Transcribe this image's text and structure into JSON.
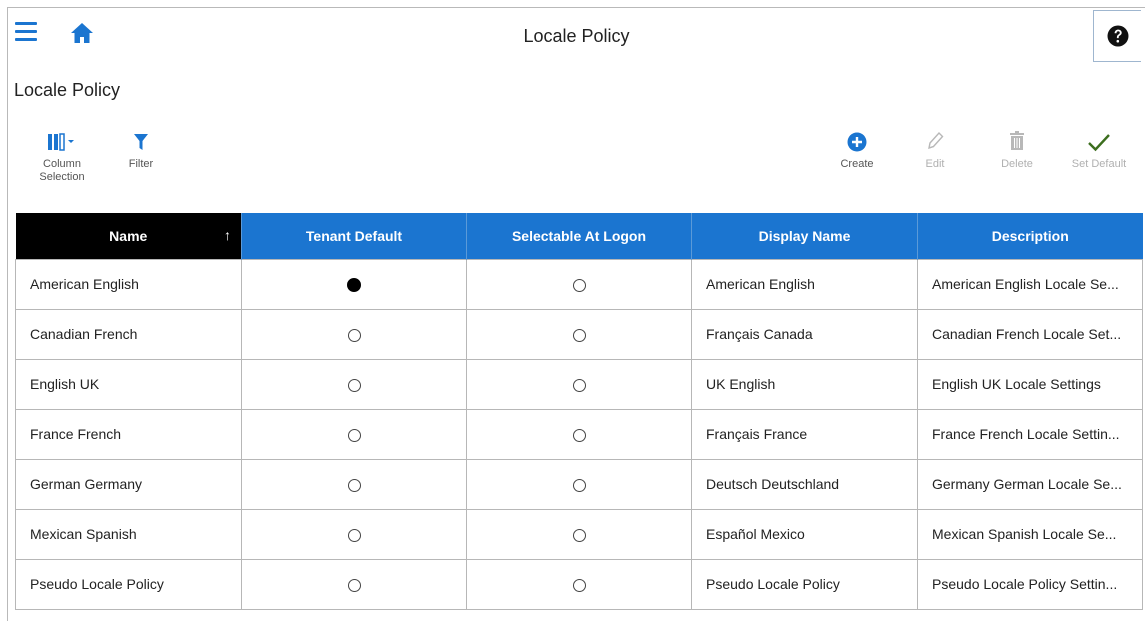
{
  "header": {
    "title": "Locale Policy"
  },
  "page": {
    "title": "Locale Policy"
  },
  "toolbar": {
    "column_selection": "Column\nSelection",
    "column_selection_line1": "Column",
    "column_selection_line2": "Selection",
    "filter": "Filter",
    "create": "Create",
    "edit": "Edit",
    "delete": "Delete",
    "set_default": "Set Default"
  },
  "colors": {
    "accent": "#1b75d0",
    "sorted_header": "#000000",
    "set_default_check": "#3c6e1e"
  },
  "table": {
    "columns": [
      "Name",
      "Tenant Default",
      "Selectable At Logon",
      "Display Name",
      "Description"
    ],
    "sort": {
      "column": "Name",
      "direction": "ascending"
    },
    "rows": [
      {
        "name": "American English",
        "tenant_default": true,
        "selectable": false,
        "display_name": "American English",
        "description": "American English Locale Se..."
      },
      {
        "name": "Canadian French",
        "tenant_default": false,
        "selectable": false,
        "display_name": "Français Canada",
        "description": "Canadian French Locale Set..."
      },
      {
        "name": "English UK",
        "tenant_default": false,
        "selectable": false,
        "display_name": "UK English",
        "description": "English UK Locale Settings"
      },
      {
        "name": "France French",
        "tenant_default": false,
        "selectable": false,
        "display_name": "Français France",
        "description": "France French Locale Settin..."
      },
      {
        "name": "German Germany",
        "tenant_default": false,
        "selectable": false,
        "display_name": "Deutsch Deutschland",
        "description": "Germany German Locale Se..."
      },
      {
        "name": "Mexican Spanish",
        "tenant_default": false,
        "selectable": false,
        "display_name": "Español Mexico",
        "description": "Mexican Spanish Locale Se..."
      },
      {
        "name": "Pseudo Locale Policy",
        "tenant_default": false,
        "selectable": false,
        "display_name": "Pseudo Locale Policy",
        "description": "Pseudo Locale Policy Settin..."
      }
    ]
  }
}
